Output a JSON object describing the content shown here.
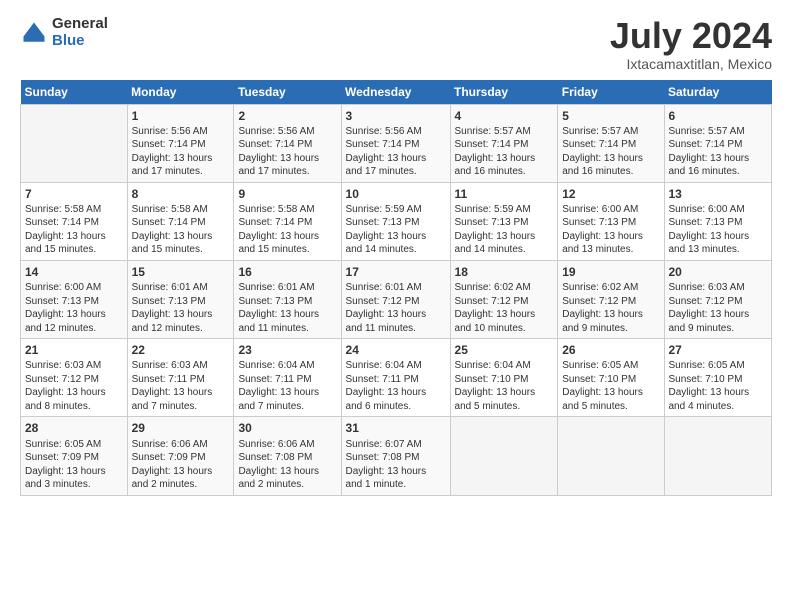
{
  "logo": {
    "general": "General",
    "blue": "Blue"
  },
  "header": {
    "title": "July 2024",
    "subtitle": "Ixtacamaxtitlan, Mexico"
  },
  "days": [
    "Sunday",
    "Monday",
    "Tuesday",
    "Wednesday",
    "Thursday",
    "Friday",
    "Saturday"
  ],
  "weeks": [
    [
      {
        "num": "",
        "info": ""
      },
      {
        "num": "1",
        "info": "Sunrise: 5:56 AM\nSunset: 7:14 PM\nDaylight: 13 hours\nand 17 minutes."
      },
      {
        "num": "2",
        "info": "Sunrise: 5:56 AM\nSunset: 7:14 PM\nDaylight: 13 hours\nand 17 minutes."
      },
      {
        "num": "3",
        "info": "Sunrise: 5:56 AM\nSunset: 7:14 PM\nDaylight: 13 hours\nand 17 minutes."
      },
      {
        "num": "4",
        "info": "Sunrise: 5:57 AM\nSunset: 7:14 PM\nDaylight: 13 hours\nand 16 minutes."
      },
      {
        "num": "5",
        "info": "Sunrise: 5:57 AM\nSunset: 7:14 PM\nDaylight: 13 hours\nand 16 minutes."
      },
      {
        "num": "6",
        "info": "Sunrise: 5:57 AM\nSunset: 7:14 PM\nDaylight: 13 hours\nand 16 minutes."
      }
    ],
    [
      {
        "num": "7",
        "info": "Sunrise: 5:58 AM\nSunset: 7:14 PM\nDaylight: 13 hours\nand 15 minutes."
      },
      {
        "num": "8",
        "info": "Sunrise: 5:58 AM\nSunset: 7:14 PM\nDaylight: 13 hours\nand 15 minutes."
      },
      {
        "num": "9",
        "info": "Sunrise: 5:58 AM\nSunset: 7:14 PM\nDaylight: 13 hours\nand 15 minutes."
      },
      {
        "num": "10",
        "info": "Sunrise: 5:59 AM\nSunset: 7:13 PM\nDaylight: 13 hours\nand 14 minutes."
      },
      {
        "num": "11",
        "info": "Sunrise: 5:59 AM\nSunset: 7:13 PM\nDaylight: 13 hours\nand 14 minutes."
      },
      {
        "num": "12",
        "info": "Sunrise: 6:00 AM\nSunset: 7:13 PM\nDaylight: 13 hours\nand 13 minutes."
      },
      {
        "num": "13",
        "info": "Sunrise: 6:00 AM\nSunset: 7:13 PM\nDaylight: 13 hours\nand 13 minutes."
      }
    ],
    [
      {
        "num": "14",
        "info": "Sunrise: 6:00 AM\nSunset: 7:13 PM\nDaylight: 13 hours\nand 12 minutes."
      },
      {
        "num": "15",
        "info": "Sunrise: 6:01 AM\nSunset: 7:13 PM\nDaylight: 13 hours\nand 12 minutes."
      },
      {
        "num": "16",
        "info": "Sunrise: 6:01 AM\nSunset: 7:13 PM\nDaylight: 13 hours\nand 11 minutes."
      },
      {
        "num": "17",
        "info": "Sunrise: 6:01 AM\nSunset: 7:12 PM\nDaylight: 13 hours\nand 11 minutes."
      },
      {
        "num": "18",
        "info": "Sunrise: 6:02 AM\nSunset: 7:12 PM\nDaylight: 13 hours\nand 10 minutes."
      },
      {
        "num": "19",
        "info": "Sunrise: 6:02 AM\nSunset: 7:12 PM\nDaylight: 13 hours\nand 9 minutes."
      },
      {
        "num": "20",
        "info": "Sunrise: 6:03 AM\nSunset: 7:12 PM\nDaylight: 13 hours\nand 9 minutes."
      }
    ],
    [
      {
        "num": "21",
        "info": "Sunrise: 6:03 AM\nSunset: 7:12 PM\nDaylight: 13 hours\nand 8 minutes."
      },
      {
        "num": "22",
        "info": "Sunrise: 6:03 AM\nSunset: 7:11 PM\nDaylight: 13 hours\nand 7 minutes."
      },
      {
        "num": "23",
        "info": "Sunrise: 6:04 AM\nSunset: 7:11 PM\nDaylight: 13 hours\nand 7 minutes."
      },
      {
        "num": "24",
        "info": "Sunrise: 6:04 AM\nSunset: 7:11 PM\nDaylight: 13 hours\nand 6 minutes."
      },
      {
        "num": "25",
        "info": "Sunrise: 6:04 AM\nSunset: 7:10 PM\nDaylight: 13 hours\nand 5 minutes."
      },
      {
        "num": "26",
        "info": "Sunrise: 6:05 AM\nSunset: 7:10 PM\nDaylight: 13 hours\nand 5 minutes."
      },
      {
        "num": "27",
        "info": "Sunrise: 6:05 AM\nSunset: 7:10 PM\nDaylight: 13 hours\nand 4 minutes."
      }
    ],
    [
      {
        "num": "28",
        "info": "Sunrise: 6:05 AM\nSunset: 7:09 PM\nDaylight: 13 hours\nand 3 minutes."
      },
      {
        "num": "29",
        "info": "Sunrise: 6:06 AM\nSunset: 7:09 PM\nDaylight: 13 hours\nand 2 minutes."
      },
      {
        "num": "30",
        "info": "Sunrise: 6:06 AM\nSunset: 7:08 PM\nDaylight: 13 hours\nand 2 minutes."
      },
      {
        "num": "31",
        "info": "Sunrise: 6:07 AM\nSunset: 7:08 PM\nDaylight: 13 hours\nand 1 minute."
      },
      {
        "num": "",
        "info": ""
      },
      {
        "num": "",
        "info": ""
      },
      {
        "num": "",
        "info": ""
      }
    ]
  ]
}
